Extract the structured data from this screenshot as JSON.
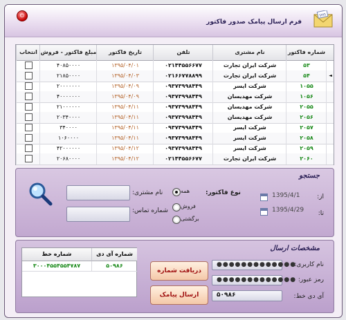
{
  "window": {
    "title": "فرم ارسال پیامک صدور فاکتور"
  },
  "grid": {
    "headers": {
      "inv": "شماره فاکتور",
      "cust": "نام مشتری",
      "tel": "تلفن",
      "date": "تاریخ فاکتور",
      "amt": "مبلغ فاکتور - فروش",
      "chk": "انتخاب"
    },
    "rows": [
      {
        "inv": "۵۳",
        "cust": "شرکت ایران تجارت",
        "tel": "۰۲۱۴۴۵۵۶۶۷۷",
        "date": "۱۳۹۵/۰۴/۰۱",
        "amt": "۴۰۸۵۰۰۰۰"
      },
      {
        "inv": "۵۴",
        "cust": "شرکت ایران تجارت",
        "tel": "۰۲۱۶۶۷۷۸۸۹۹",
        "date": "۱۳۹۵/۰۴/۰۳",
        "amt": "۲۱۸۵۰۰۰۰"
      },
      {
        "inv": "۱۰۵۵",
        "cust": "شرکت ایسر",
        "tel": "۰۹۳۷۳۹۹۸۴۴۹",
        "date": "۱۳۹۵/۰۴/۰۹",
        "amt": "۲۰۰۰۰۰۰۰"
      },
      {
        "inv": "۱۰۵۶",
        "cust": "شرکت مهدیسان",
        "tel": "۰۹۳۷۳۹۹۸۴۴۹",
        "date": "۱۳۹۵/۰۴/۰۹",
        "amt": "۴۰۰۰۰۰۰۰"
      },
      {
        "inv": "۲۰۵۵",
        "cust": "شرکت مهدیسان",
        "tel": "۰۹۳۷۳۹۹۸۴۴۹",
        "date": "۱۳۹۵/۰۴/۱۱",
        "amt": "۲۱۰۰۰۰۰۰"
      },
      {
        "inv": "۲۰۵۶",
        "cust": "شرکت مهدیسان",
        "tel": "۰۹۳۷۳۹۹۸۴۴۹",
        "date": "۱۳۹۵/۰۴/۱۱",
        "amt": "۲۰۳۴۰۰۰۰"
      },
      {
        "inv": "۲۰۵۷",
        "cust": "شرکت ایسر",
        "tel": "۰۹۳۷۳۹۹۸۴۴۹",
        "date": "۱۳۹۵/۰۴/۱۱",
        "amt": "۳۴۰۰۰۰"
      },
      {
        "inv": "۲۰۵۸",
        "cust": "شرکت ایسر",
        "tel": "۰۹۳۷۳۹۹۸۴۴۹",
        "date": "۱۳۹۵/۰۴/۱۱",
        "amt": "۱۰۶۰۰۰۰"
      },
      {
        "inv": "۲۰۵۹",
        "cust": "شرکت ایسر",
        "tel": "۰۹۳۷۳۹۹۸۴۴۹",
        "date": "۱۳۹۵/۰۴/۱۲",
        "amt": "۴۲۰۰۰۰۰۰"
      },
      {
        "inv": "۲۰۶۰",
        "cust": "شرکت ایران تجارت",
        "tel": "۰۲۱۴۴۵۵۶۶۷۷",
        "date": "۱۳۹۵/۰۴/۱۲",
        "amt": "۲۰۶۸۰۰۰۰"
      }
    ]
  },
  "search": {
    "title": "جستجو",
    "from_label": "از:",
    "to_label": "تا:",
    "from_date": "1395/4/1",
    "to_date": "1395/4/29",
    "type_label": "نوع فاکتور:",
    "type_options": [
      "همه",
      "فروش",
      "برگشتی"
    ],
    "customer_label": "نام مشتری:",
    "contact_label": "شماره تماس:"
  },
  "sender": {
    "title": "مشخصات ارسال",
    "username_label": "نام کاربری:",
    "password_label": "رمز عبور:",
    "id_label": "آی دی خط:",
    "username_value": "●●●●●●●●●●●●●",
    "password_value": "●●●●●●●●●●●●●",
    "id_value": "۵۰۹۸۶",
    "serial_button": "دریافت شماره سریال",
    "send_button": "ارسال پیامک",
    "table_headers": {
      "line": "شماره خط",
      "id": "شماره آی دی"
    },
    "table_row": {
      "line": "۳۰۰۰۴۵۵۴۵۵۴۷۸۷",
      "id": "۵۰۹۸۶"
    }
  }
}
